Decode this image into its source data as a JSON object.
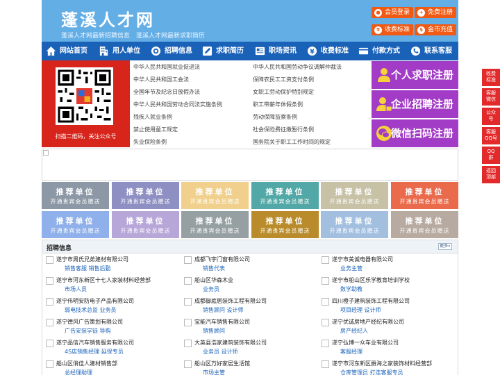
{
  "header": {
    "site_name": "蓬溪人才网",
    "tagline": "蓬溪人才网最新招聘信息　蓬溪人才网最新求职简历",
    "buttons": [
      {
        "label": "会员登录",
        "icon": "user-icon"
      },
      {
        "label": "免费注册",
        "icon": "person-add-icon"
      },
      {
        "label": "收费标准",
        "icon": "yen-icon"
      },
      {
        "label": "金币充值",
        "icon": "coin-icon"
      }
    ],
    "button_color": "#f05a14",
    "bg_color": "#64aee6"
  },
  "nav": {
    "bg_color": "#1a62b8",
    "items": [
      {
        "label": "网站首页",
        "icon": "home-icon"
      },
      {
        "label": "用人单位",
        "icon": "building-icon"
      },
      {
        "label": "招聘信息",
        "icon": "broadcast-icon"
      },
      {
        "label": "求职简历",
        "icon": "pen-icon"
      },
      {
        "label": "职场资讯",
        "icon": "news-icon"
      },
      {
        "label": "收费标准",
        "icon": "yen-icon"
      },
      {
        "label": "付款方式",
        "icon": "card-icon"
      },
      {
        "label": "联系客服",
        "icon": "phone-icon"
      }
    ]
  },
  "qr": {
    "caption": "扫描二维码，关注公众号"
  },
  "laws": [
    "中华人民共和国就业促进法",
    "中华人民共和国劳动争议调解仲裁法",
    "中华人民共和国工会法",
    "保障农民工工资支付条例",
    "全国年节及纪念日放假办法",
    "女职工劳动保护特别规定",
    "中华人民共和国劳动合同法实施条例",
    "职工带薪年休假条例",
    "残疾人就业条例",
    "劳动保障监察条例",
    "禁止使用童工规定",
    "社会保险费征缴暂行条例",
    "失业保险条例",
    "国务院关于职工工作时间的规定"
  ],
  "register": [
    {
      "label": "个人求职注册",
      "icon": "person-icon"
    },
    {
      "label": "企业招聘注册",
      "icon": "company-user-icon"
    },
    {
      "label": "微信扫码注册",
      "icon": "wechat-icon"
    }
  ],
  "tiles": {
    "title": "推荐单位",
    "subtitle": "开通贵宾会员赠送",
    "colors": [
      "#8d98a6",
      "#8e8fc2",
      "#f0d08c",
      "#52a8a6",
      "#c7c1a6",
      "#ea6a4c",
      "#8fb0ea",
      "#b7a6d8",
      "#96a0a3",
      "#b98b2a",
      "#a3bfe0",
      "#b7aaa0"
    ]
  },
  "jobs": {
    "title": "招聘信息",
    "more_label": "更多»",
    "rows": [
      [
        {
          "company": "遂宁市周氏兄弟建材有限公司",
          "positions": "销售客服 销售后勤"
        },
        {
          "company": "成都飞宇门窗有限公司",
          "positions": "销售代表"
        },
        {
          "company": "遂宁市美诚电器有限公司",
          "positions": "业务主管"
        }
      ],
      [
        {
          "company": "遂宁市河东新区十七人家装材料经营部",
          "positions": "市场人员"
        },
        {
          "company": "船山区华森木业",
          "positions": "业务员"
        },
        {
          "company": "遂宁市船山区乐学教育培训学校",
          "positions": "数学助教"
        }
      ],
      [
        {
          "company": "遂宁伟明安防电子产品有限公司",
          "positions": "弱电技术总监 业务员"
        },
        {
          "company": "成都御庭居装饰工程有限公司",
          "positions": "销售顾问 设计师"
        },
        {
          "company": "四川橙子建筑装饰工程有限公司",
          "positions": "项目经理 设计师"
        }
      ],
      [
        {
          "company": "遂宁德风广告策划有限公司",
          "positions": "广告安装学徒 导购"
        },
        {
          "company": "宝能汽车销售有限公司",
          "positions": "销售顾问"
        },
        {
          "company": "遂宁优诚房地产经纪有限公司",
          "positions": "房产经纪人"
        }
      ],
      [
        {
          "company": "遂宁品信汽车销售服务有限公司",
          "positions": "4S店销售经理 延保专员"
        },
        {
          "company": "大英县浩家建筑装饰有限公司",
          "positions": "业务员 设计师"
        },
        {
          "company": "遂宁弘博一众车业有限公司",
          "positions": "客服经理"
        }
      ],
      [
        {
          "company": "船山区俏佳人建材销售部",
          "positions": "总经理助理"
        },
        {
          "company": "船山区万好家居生活馆",
          "positions": "市场主管"
        },
        {
          "company": "遂宁市河东新区爵海之家装饰材料经营部",
          "positions": "仓库管理员 打连客服专员"
        }
      ]
    ]
  },
  "side": [
    {
      "label": "收费\n标准"
    },
    {
      "label": "客服\n微信"
    },
    {
      "label": "公众\n号"
    },
    {
      "label": "客服\nQQ号"
    },
    {
      "label": "QQ\n群"
    },
    {
      "label": "返回\n顶部"
    }
  ],
  "side_color": "#e32a2a"
}
